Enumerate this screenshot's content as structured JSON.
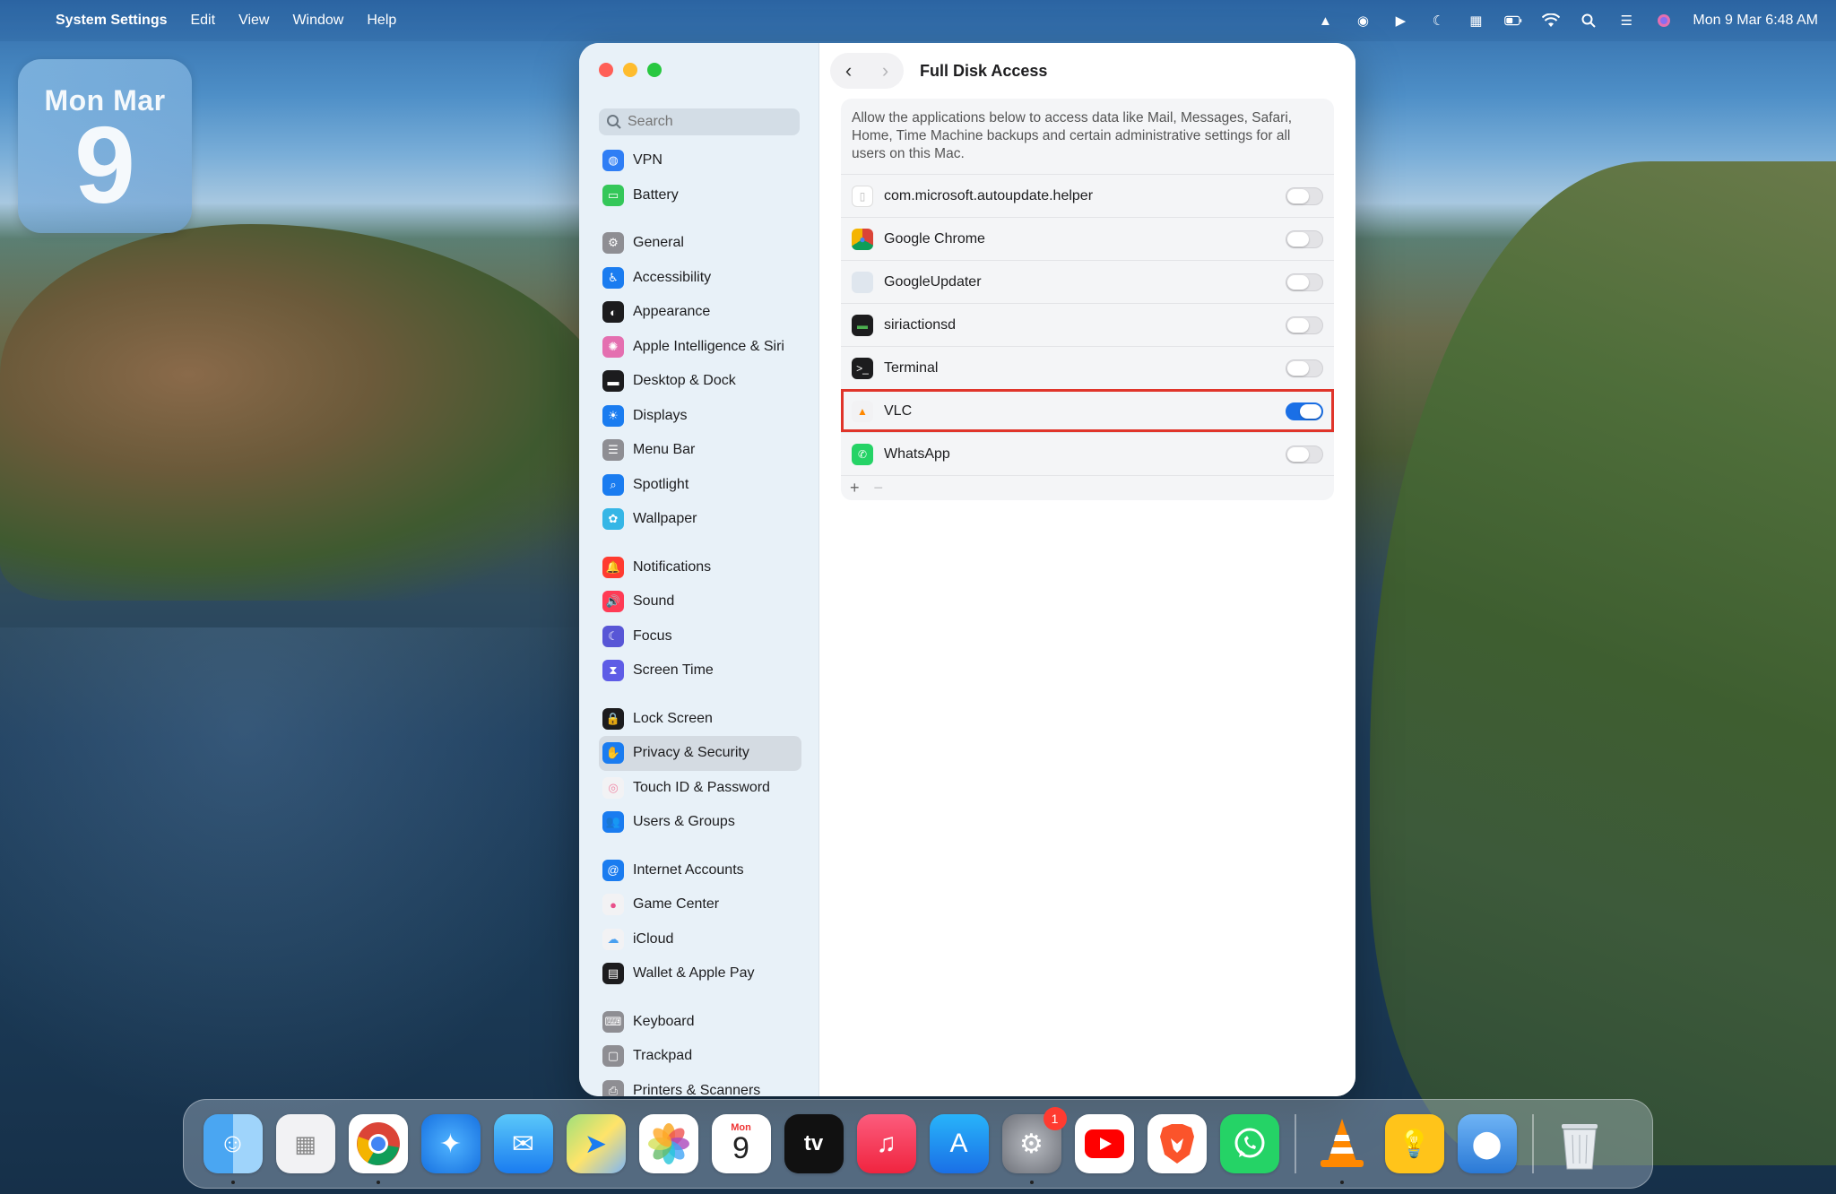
{
  "menubar": {
    "app_name": "System Settings",
    "menus": [
      "Edit",
      "View",
      "Window",
      "Help"
    ],
    "clock": "Mon 9 Mar  6:48 AM"
  },
  "widget": {
    "month": "Mon Mar",
    "day": "9"
  },
  "sidebar": {
    "search_placeholder": "Search",
    "items": [
      {
        "label": "VPN",
        "icon": "globe-icon",
        "color": "#2f7ef5"
      },
      {
        "label": "Battery",
        "icon": "battery-icon",
        "color": "#34c759"
      },
      {
        "label": "General",
        "icon": "gear-icon",
        "color": "#8e8e93"
      },
      {
        "label": "Accessibility",
        "icon": "accessibility-icon",
        "color": "#1a7cf0"
      },
      {
        "label": "Appearance",
        "icon": "appearance-icon",
        "color": "#1c1c1e"
      },
      {
        "label": "Apple Intelligence & Siri",
        "icon": "siri-icon",
        "color": "#e46fb0"
      },
      {
        "label": "Desktop & Dock",
        "icon": "dock-icon",
        "color": "#1c1c1e"
      },
      {
        "label": "Displays",
        "icon": "sun-icon",
        "color": "#1a7cf0"
      },
      {
        "label": "Menu Bar",
        "icon": "menubar-icon",
        "color": "#8e8e93"
      },
      {
        "label": "Spotlight",
        "icon": "magnifier-icon",
        "color": "#1a7cf0"
      },
      {
        "label": "Wallpaper",
        "icon": "flower-icon",
        "color": "#35b6e6"
      },
      {
        "label": "Notifications",
        "icon": "bell-icon",
        "color": "#ff3b30"
      },
      {
        "label": "Sound",
        "icon": "speaker-icon",
        "color": "#ff3b55"
      },
      {
        "label": "Focus",
        "icon": "moon-icon",
        "color": "#5856d6"
      },
      {
        "label": "Screen Time",
        "icon": "hourglass-icon",
        "color": "#5e5ce6"
      },
      {
        "label": "Lock Screen",
        "icon": "lock-icon",
        "color": "#1c1c1e"
      },
      {
        "label": "Privacy & Security",
        "icon": "hand-icon",
        "color": "#1a7cf0"
      },
      {
        "label": "Touch ID & Password",
        "icon": "fingerprint-icon",
        "color": "#f2f2f4"
      },
      {
        "label": "Users & Groups",
        "icon": "users-icon",
        "color": "#1a7cf0"
      },
      {
        "label": "Internet Accounts",
        "icon": "at-icon",
        "color": "#1a7cf0"
      },
      {
        "label": "Game Center",
        "icon": "gamecenter-icon",
        "color": "#f2f2f4"
      },
      {
        "label": "iCloud",
        "icon": "cloud-icon",
        "color": "#f2f2f4"
      },
      {
        "label": "Wallet & Apple Pay",
        "icon": "wallet-icon",
        "color": "#1c1c1e"
      },
      {
        "label": "Keyboard",
        "icon": "keyboard-icon",
        "color": "#8e8e93"
      },
      {
        "label": "Trackpad",
        "icon": "trackpad-icon",
        "color": "#8e8e93"
      },
      {
        "label": "Printers & Scanners",
        "icon": "printer-icon",
        "color": "#8e8e93"
      }
    ]
  },
  "content": {
    "title": "Full Disk Access",
    "description": "Allow the applications below to access data like Mail, Messages, Safari, Home, Time Machine backups and certain administrative settings for all users on this Mac.",
    "apps": [
      {
        "name": "com.microsoft.autoupdate.helper",
        "icon": "document-icon",
        "enabled": false
      },
      {
        "name": "Google Chrome",
        "icon": "chrome-icon",
        "enabled": false
      },
      {
        "name": "GoogleUpdater",
        "icon": "googleupdater-icon",
        "enabled": false
      },
      {
        "name": "siriactionsd",
        "icon": "terminal-exec-icon",
        "enabled": false
      },
      {
        "name": "Terminal",
        "icon": "terminal-icon",
        "enabled": false
      },
      {
        "name": "VLC",
        "icon": "vlc-cone-icon",
        "enabled": true
      },
      {
        "name": "WhatsApp",
        "icon": "whatsapp-icon",
        "enabled": false
      }
    ],
    "add_label": "+",
    "remove_label": "−"
  },
  "dock": {
    "calendar_month": "Mon",
    "calendar_day": "9",
    "settings_badge": "1"
  }
}
